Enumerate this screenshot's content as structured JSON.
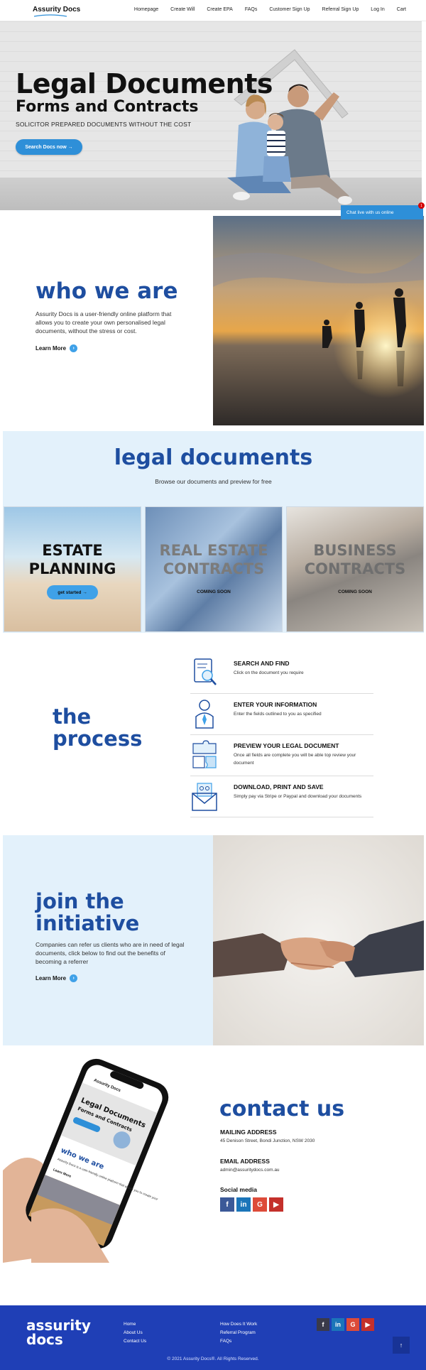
{
  "header": {
    "logo": "Assurity Docs",
    "nav": [
      "Homepage",
      "Create Will",
      "Create EPA",
      "FAQs",
      "Customer Sign Up",
      "Referral Sign Up",
      "Log In",
      "Cart"
    ]
  },
  "hero": {
    "title": "Legal Documents",
    "subtitle": "Forms and Contracts",
    "tagline": "SOLICITOR PREPARED DOCUMENTS WITHOUT THE COST",
    "button": "Search Docs now  →"
  },
  "chat": {
    "label": "Chat live with us online",
    "badge": "1"
  },
  "who": {
    "title": "who we are",
    "text": "Assurity Docs is a user-friendly online platform that allows you to create your own personalised legal documents, without the stress or cost.",
    "learn_more": "Learn More"
  },
  "legal": {
    "title": "legal documents",
    "subtitle": "Browse our documents and preview for free",
    "cards": [
      {
        "title_line1": "ESTATE",
        "title_line2": "PLANNING",
        "action": "get started  →"
      },
      {
        "title_line1": "REAL ESTATE",
        "title_line2": "CONTRACTS",
        "action": "COMING SOON"
      },
      {
        "title_line1": "BUSINESS",
        "title_line2": "CONTRACTS",
        "action": "COMING SOON"
      }
    ]
  },
  "process": {
    "title_line1": "the",
    "title_line2": "process",
    "steps": [
      {
        "icon": "search-document-icon",
        "heading": "SEARCH AND FIND",
        "text": "Click on the document you require"
      },
      {
        "icon": "person-icon",
        "heading": "ENTER YOUR INFORMATION",
        "text": "Enter the fields outlined to you as specified"
      },
      {
        "icon": "puzzle-icon",
        "heading": "PREVIEW YOUR LEGAL DOCUMENT",
        "text": "Once all fields are complete you will be able top review your document"
      },
      {
        "icon": "envelope-icon",
        "heading": "DOWNLOAD, PRINT AND SAVE",
        "text": "Simply pay via Stripe or Paypal and download your documents"
      }
    ]
  },
  "join": {
    "title_line1": "join the",
    "title_line2": "initiative",
    "text": "Companies can refer us clients who are in need of legal documents, click below to find out the benefits of becoming a referrer",
    "learn_more": "Learn More"
  },
  "phone_mock": {
    "logo": "Assurity Docs",
    "title": "Legal Documents",
    "subtitle": "Forms and Contracts",
    "heading": "who we are",
    "text": "Assurity Docs is a user-friendly online platform that allows you to create your",
    "learn_more": "Learn More"
  },
  "contact": {
    "title": "contact us",
    "mailing_heading": "MAILING ADDRESS",
    "mailing_value": "45 Denison Street, Bondi Junction, NSW 2030",
    "email_heading": "EMAIL ADDRESS",
    "email_value": "admin@assuritydocs.com.au",
    "social_heading": "Social media"
  },
  "footer": {
    "logo_line1": "assurity",
    "logo_line2": "docs",
    "col1": [
      "Home",
      "About Us",
      "Contact Us"
    ],
    "col2": [
      "How Does It Work",
      "Referral Program",
      "FAQs"
    ],
    "copyright": "© 2021 Assurity Docs®. All Rights Reserved.",
    "to_top": "↑"
  },
  "colors": {
    "brand_blue": "#1e4ea0",
    "accent": "#2e8fd8",
    "light_bg": "#e3f1fb",
    "footer": "#1f3fb6"
  }
}
